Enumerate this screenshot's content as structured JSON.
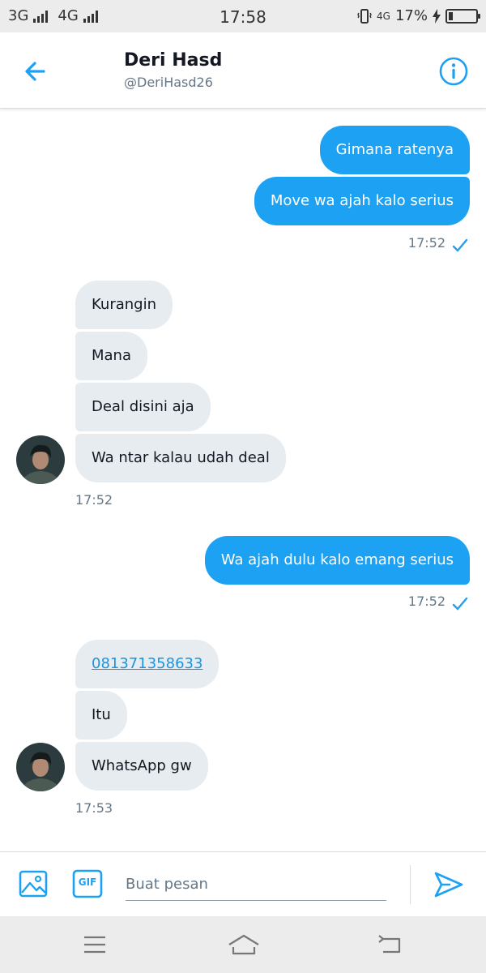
{
  "status_bar": {
    "network_1": "3G",
    "network_2": "4G",
    "time": "17:58",
    "data_label": "4G",
    "battery": "17%",
    "battery_level": 0.17
  },
  "header": {
    "name": "Deri Hasd",
    "handle": "@DeriHasd26",
    "back_icon": "arrow-left-icon",
    "info_icon": "info-icon",
    "accent": "#1da1f2"
  },
  "messages": [
    {
      "from": "me",
      "text": "Gimana ratenya"
    },
    {
      "from": "me",
      "text": "Move wa ajah kalo serius"
    },
    {
      "from": "me",
      "time": "17:52"
    },
    {
      "from": "them",
      "text": "Kurangin"
    },
    {
      "from": "them",
      "text": "Mana"
    },
    {
      "from": "them",
      "text": "Deal disini aja"
    },
    {
      "from": "them",
      "text": "Wa ntar kalau udah deal"
    },
    {
      "from": "them",
      "time": "17:52"
    },
    {
      "from": "me",
      "text": "Wa ajah dulu kalo emang serius"
    },
    {
      "from": "me",
      "time": "17:52"
    },
    {
      "from": "them",
      "text": "081371358633"
    },
    {
      "from": "them",
      "text": "Itu"
    },
    {
      "from": "them",
      "text": "WhatsApp gw"
    },
    {
      "from": "them",
      "time": "17:53"
    }
  ],
  "composer": {
    "placeholder": "Buat pesan",
    "value": "",
    "gif_label": "GIF",
    "image_icon": "image-icon",
    "send_icon": "send-icon"
  },
  "nav": {
    "icons": [
      "menu-icon",
      "home-icon",
      "back-icon"
    ]
  }
}
